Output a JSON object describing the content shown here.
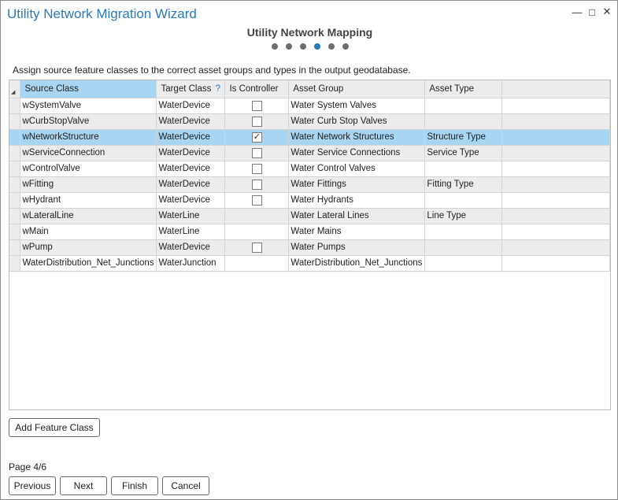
{
  "window": {
    "title": "Utility Network Migration Wizard",
    "controls": {
      "minimize": "—",
      "maximize": "□",
      "close": "✕"
    }
  },
  "step": {
    "title": "Utility Network Mapping",
    "total_steps": 6,
    "current_step": 4
  },
  "instructions": "Assign source feature classes to the correct asset groups and types in the output geodatabase.",
  "grid": {
    "columns": [
      {
        "label": "Source Class",
        "sorted": true
      },
      {
        "label": "Target Class",
        "help": "?"
      },
      {
        "label": "Is Controller"
      },
      {
        "label": "Asset Group"
      },
      {
        "label": "Asset Type"
      },
      {
        "label": ""
      }
    ],
    "rows": [
      {
        "source": "wSystemValve",
        "target": "WaterDevice",
        "has_checkbox": true,
        "checked": false,
        "asset_group": "Water System Valves",
        "asset_type": ""
      },
      {
        "source": "wCurbStopValve",
        "target": "WaterDevice",
        "has_checkbox": true,
        "checked": false,
        "asset_group": "Water Curb Stop Valves",
        "asset_type": ""
      },
      {
        "source": "wNetworkStructure",
        "target": "WaterDevice",
        "has_checkbox": true,
        "checked": true,
        "asset_group": "Water Network Structures",
        "asset_type": "Structure Type",
        "selected": true
      },
      {
        "source": "wServiceConnection",
        "target": "WaterDevice",
        "has_checkbox": true,
        "checked": false,
        "asset_group": "Water Service Connections",
        "asset_type": "Service Type"
      },
      {
        "source": "wControlValve",
        "target": "WaterDevice",
        "has_checkbox": true,
        "checked": false,
        "asset_group": "Water Control Valves",
        "asset_type": ""
      },
      {
        "source": "wFitting",
        "target": "WaterDevice",
        "has_checkbox": true,
        "checked": false,
        "asset_group": "Water Fittings",
        "asset_type": "Fitting Type"
      },
      {
        "source": "wHydrant",
        "target": "WaterDevice",
        "has_checkbox": true,
        "checked": false,
        "asset_group": "Water Hydrants",
        "asset_type": ""
      },
      {
        "source": "wLateralLine",
        "target": "WaterLine",
        "has_checkbox": false,
        "checked": false,
        "asset_group": "Water Lateral Lines",
        "asset_type": "Line Type"
      },
      {
        "source": "wMain",
        "target": "WaterLine",
        "has_checkbox": false,
        "checked": false,
        "asset_group": "Water Mains",
        "asset_type": ""
      },
      {
        "source": "wPump",
        "target": "WaterDevice",
        "has_checkbox": true,
        "checked": false,
        "asset_group": "Water Pumps",
        "asset_type": ""
      },
      {
        "source": "WaterDistribution_Net_Junctions",
        "target": "WaterJunction",
        "has_checkbox": false,
        "checked": false,
        "asset_group": "WaterDistribution_Net_Junctions",
        "asset_type": ""
      }
    ]
  },
  "buttons": {
    "add_feature_class": "Add Feature Class",
    "previous": "Previous",
    "next": "Next",
    "finish": "Finish",
    "cancel": "Cancel"
  },
  "page_label": "Page 4/6",
  "colors": {
    "accent": "#2a7ab8",
    "selection": "#a8d6f2",
    "alt_row": "#ececec"
  }
}
